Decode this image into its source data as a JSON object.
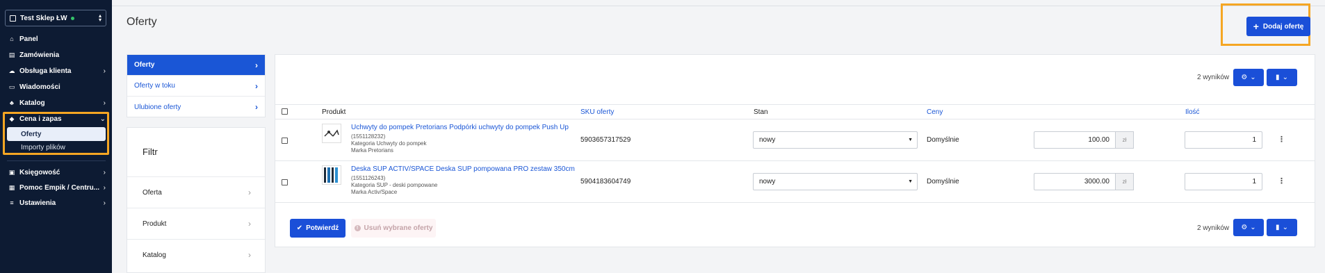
{
  "sidebar": {
    "shop_name": "Test Sklep ŁW",
    "items": [
      {
        "label": "Panel",
        "icon": "home-icon"
      },
      {
        "label": "Zamówienia",
        "icon": "orders-icon"
      },
      {
        "label": "Obsługa klienta",
        "icon": "support-icon"
      },
      {
        "label": "Wiadomości",
        "icon": "messages-icon"
      },
      {
        "label": "Katalog",
        "icon": "catalog-icon"
      },
      {
        "label": "Cena i zapas",
        "icon": "tag-icon"
      },
      {
        "label": "Księgowość",
        "icon": "accounting-icon"
      },
      {
        "label": "Pomoc Empik / Centru...",
        "icon": "help-icon"
      },
      {
        "label": "Ustawienia",
        "icon": "settings-icon"
      }
    ],
    "sub_items": [
      {
        "label": "Oferty",
        "active": true
      },
      {
        "label": "Importy plików",
        "active": false
      }
    ]
  },
  "header": {
    "title": "Oferty",
    "add_button": "Dodaj ofertę"
  },
  "tabs": [
    {
      "label": "Oferty",
      "active": true
    },
    {
      "label": "Oferty w toku",
      "active": false
    },
    {
      "label": "Ulubione oferty",
      "active": false
    }
  ],
  "filter": {
    "title": "Filtr",
    "rows": [
      "Oferta",
      "Produkt",
      "Katalog"
    ]
  },
  "table": {
    "results_label": "2 wyników",
    "columns": {
      "product": "Produkt",
      "sku": "SKU oferty",
      "state": "Stan",
      "prices": "Ceny",
      "quantity": "Ilość"
    },
    "rows": [
      {
        "name": "Uchwyty do pompek Pretorians Podpórki uchwyty do pompek Push Up",
        "id": "(1551128232)",
        "category": "Kategoria Uchwyty do pompek",
        "brand": "Marka Pretorians",
        "sku": "5903657317529",
        "state": "nowy",
        "price_type": "Domyślnie",
        "price": "100.00",
        "currency": "zł",
        "quantity": "1"
      },
      {
        "name": "Deska SUP ACTIV/SPACE Deska SUP pompowana PRO zestaw 350cm",
        "id": "(1551126243)",
        "category": "Kategoria SUP - deski pompowane",
        "brand": "Marka Activ/Space",
        "sku": "5904183604749",
        "state": "nowy",
        "price_type": "Domyślnie",
        "price": "3000.00",
        "currency": "zł",
        "quantity": "1"
      }
    ]
  },
  "footer": {
    "confirm_button": "Potwierdź",
    "delete_button": "Usuń wybrane oferty"
  },
  "colors": {
    "sidebar_bg": "#0d1b33",
    "accent": "#1a4fd8",
    "highlight": "#f5a623"
  }
}
